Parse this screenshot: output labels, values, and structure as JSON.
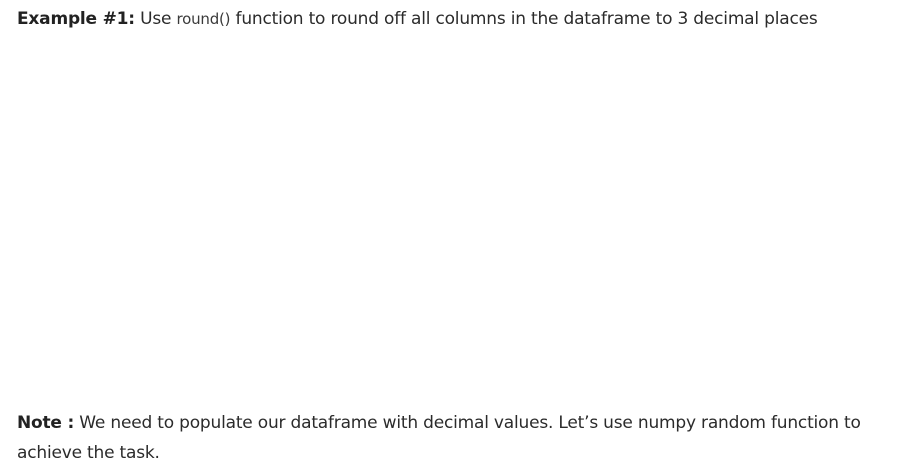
{
  "example": {
    "label": "Example #1:",
    "pre_text": " Use ",
    "code": "round()",
    "post_text": " function to round off all columns in the dataframe to 3 decimal places"
  },
  "note": {
    "label": "Note :",
    "text": " We need to populate our dataframe with decimal values. Let’s use numpy random function to achieve the task."
  }
}
